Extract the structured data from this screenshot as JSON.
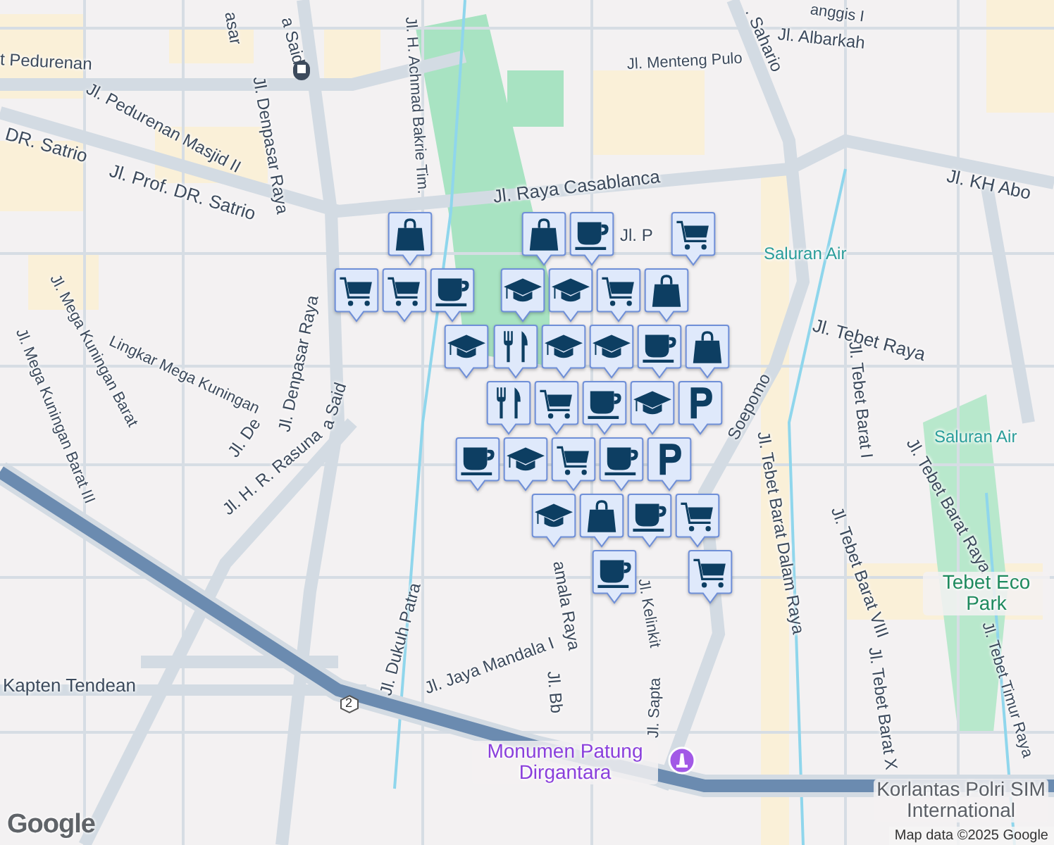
{
  "map": {
    "labels": [
      {
        "text": "t Pedurenan",
        "kind": "street"
      },
      {
        "text": "Jl. Pedurenan Masjid II",
        "kind": "street"
      },
      {
        "text": "asar",
        "kind": "street"
      },
      {
        "text": "Jl. Denpasar Raya",
        "kind": "street"
      },
      {
        "text": "a Said",
        "kind": "street"
      },
      {
        "text": "Jl. H. Achmad Bakrie Tim.",
        "kind": "street"
      },
      {
        "text": "DR. Satrio",
        "kind": "street"
      },
      {
        "text": "Jl. Prof. DR. Satrio",
        "kind": "street"
      },
      {
        "text": "Jl. Raya Casablanca",
        "kind": "street"
      },
      {
        "text": "Jl. Menteng Pulo",
        "kind": "street"
      },
      {
        "text": ". Sahario",
        "kind": "street"
      },
      {
        "text": "Jl. Albarkah",
        "kind": "street"
      },
      {
        "text": "anggis I",
        "kind": "street"
      },
      {
        "text": "Jl. KH Abo",
        "kind": "street"
      },
      {
        "text": "Jl. P",
        "kind": "street"
      },
      {
        "text": "Saluran Air",
        "kind": "water"
      },
      {
        "text": "Jl. Tebet Raya",
        "kind": "street"
      },
      {
        "text": "Soepomo",
        "kind": "street"
      },
      {
        "text": "Jl. Tebet Barat I",
        "kind": "street"
      },
      {
        "text": "Jl. Tebet Barat Dalam Raya",
        "kind": "street"
      },
      {
        "text": "Saluran Air",
        "kind": "water"
      },
      {
        "text": "Jl. Tebet Barat Raya",
        "kind": "street"
      },
      {
        "text": "Jl. Tebet Barat VIII",
        "kind": "street"
      },
      {
        "text": "Tebet Eco Park",
        "kind": "park"
      },
      {
        "text": "Jl. Tebet Barat X",
        "kind": "street"
      },
      {
        "text": "Jl. Tebet Timur Raya",
        "kind": "street"
      },
      {
        "text": "Lingkar Mega Kuningan",
        "kind": "street"
      },
      {
        "text": "Jl. Mega Kuningan Barat",
        "kind": "street"
      },
      {
        "text": "Jl. Mega Kuningan Barat III",
        "kind": "street"
      },
      {
        "text": "Jl. Denpasar Raya",
        "kind": "street"
      },
      {
        "text": "a Said",
        "kind": "street"
      },
      {
        "text": "Jl. De",
        "kind": "street"
      },
      {
        "text": "Jl. H. R. Rasuna",
        "kind": "street"
      },
      {
        "text": "Jl. Dukuh Patra",
        "kind": "street"
      },
      {
        "text": "Jl. Jaya Mandala I",
        "kind": "street"
      },
      {
        "text": "amala Raya",
        "kind": "street"
      },
      {
        "text": "Jl. Kelinkit",
        "kind": "street"
      },
      {
        "text": "Jl. Bb",
        "kind": "street"
      },
      {
        "text": "Jl. Sapta",
        "kind": "street"
      },
      {
        "text": "Kapten Tendean",
        "kind": "street"
      },
      {
        "text": "Monumen Patung Dirgantara",
        "kind": "landmark"
      },
      {
        "text": "Korlantas Polri SIM International",
        "kind": "place"
      }
    ],
    "markers": [
      {
        "kind": "bag"
      },
      {
        "kind": "bag"
      },
      {
        "kind": "cup"
      },
      {
        "kind": "cart"
      },
      {
        "kind": "cart"
      },
      {
        "kind": "cart"
      },
      {
        "kind": "cup"
      },
      {
        "kind": "cap"
      },
      {
        "kind": "cap"
      },
      {
        "kind": "cart"
      },
      {
        "kind": "bag"
      },
      {
        "kind": "cap"
      },
      {
        "kind": "fork"
      },
      {
        "kind": "cap"
      },
      {
        "kind": "cap"
      },
      {
        "kind": "cup"
      },
      {
        "kind": "bag"
      },
      {
        "kind": "fork"
      },
      {
        "kind": "cart"
      },
      {
        "kind": "cup"
      },
      {
        "kind": "cap"
      },
      {
        "kind": "parking"
      },
      {
        "kind": "cup"
      },
      {
        "kind": "cap"
      },
      {
        "kind": "cart"
      },
      {
        "kind": "cup"
      },
      {
        "kind": "parking"
      },
      {
        "kind": "cap"
      },
      {
        "kind": "bag"
      },
      {
        "kind": "cup"
      },
      {
        "kind": "cart"
      },
      {
        "kind": "cup"
      },
      {
        "kind": "cart"
      }
    ],
    "route_shield": "2",
    "logo": "Google",
    "attribution": "Map data ©2025 Google"
  }
}
